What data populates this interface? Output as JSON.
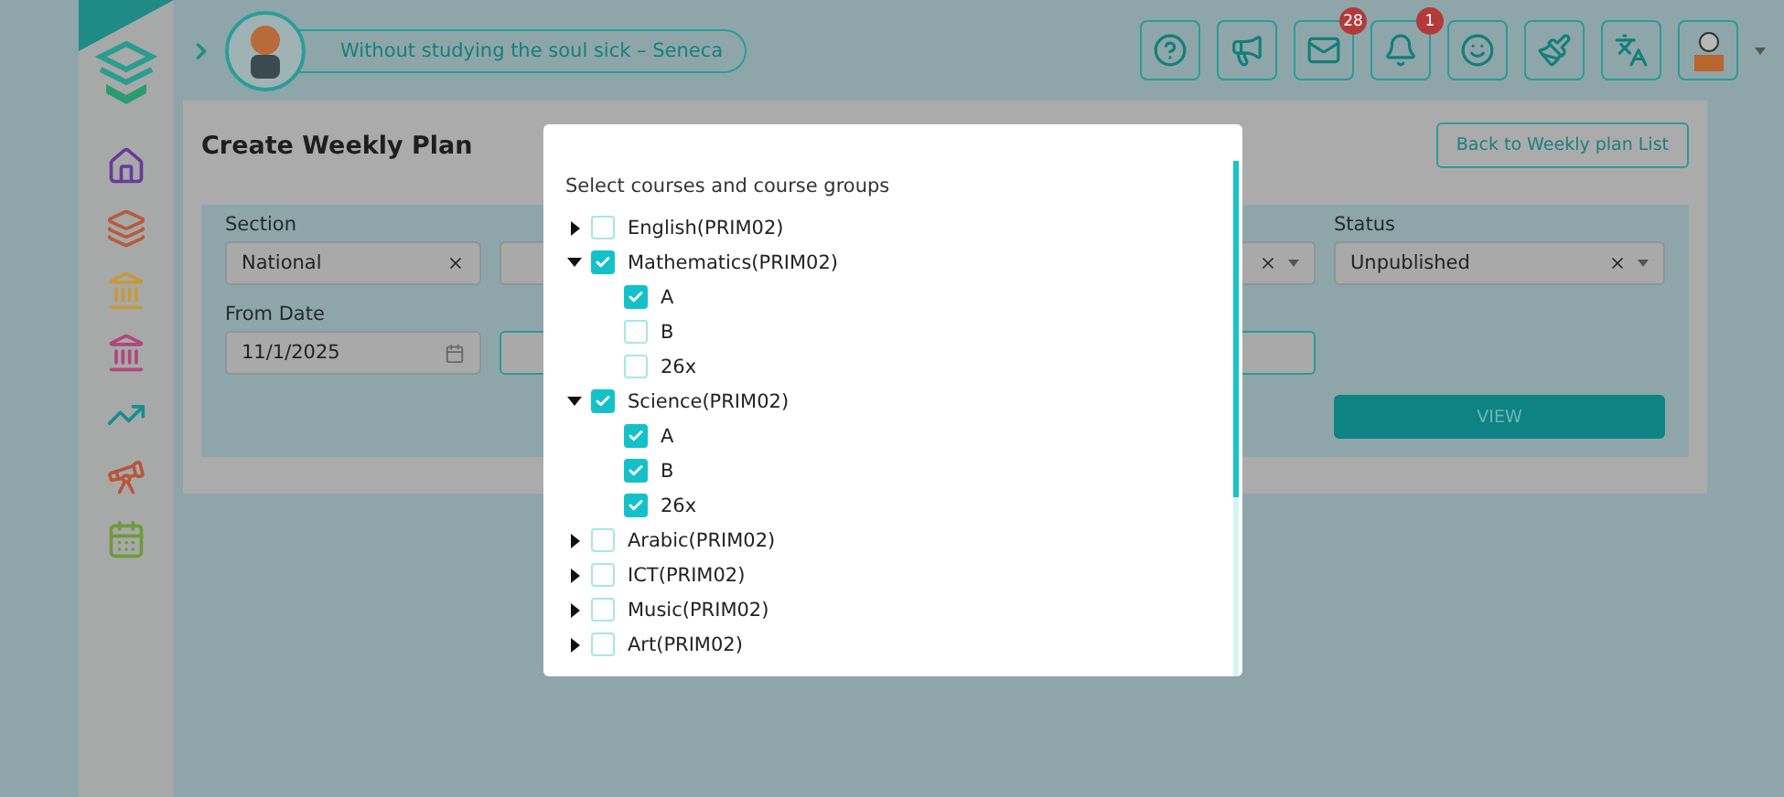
{
  "header": {
    "quote": "Without studying the soul sick – Seneca",
    "badges": {
      "mail": "28",
      "bell": "1"
    }
  },
  "page": {
    "title": "Create Weekly Plan",
    "back_button": "Back to Weekly plan List"
  },
  "filters": {
    "section": {
      "label": "Section",
      "value": "National"
    },
    "from_date": {
      "label": "From Date",
      "value": "11/1/2025"
    },
    "status": {
      "label": "Status",
      "value": "Unpublished"
    },
    "view_button": "VIEW"
  },
  "modal": {
    "heading": "Select courses and course groups",
    "courses": [
      {
        "label": "English(PRIM02)",
        "checked": false,
        "expanded": false
      },
      {
        "label": "Mathematics(PRIM02)",
        "checked": true,
        "expanded": true,
        "children": [
          {
            "label": "A",
            "checked": true
          },
          {
            "label": "B",
            "checked": false
          },
          {
            "label": "26x",
            "checked": false
          }
        ]
      },
      {
        "label": "Science(PRIM02)",
        "checked": true,
        "expanded": true,
        "children": [
          {
            "label": "A",
            "checked": true
          },
          {
            "label": "B",
            "checked": true
          },
          {
            "label": "26x",
            "checked": true
          }
        ]
      },
      {
        "label": "Arabic(PRIM02)",
        "checked": false,
        "expanded": false
      },
      {
        "label": "ICT(PRIM02)",
        "checked": false,
        "expanded": false
      },
      {
        "label": "Music(PRIM02)",
        "checked": false,
        "expanded": false
      },
      {
        "label": "Art(PRIM02)",
        "checked": false,
        "expanded": false
      }
    ]
  }
}
